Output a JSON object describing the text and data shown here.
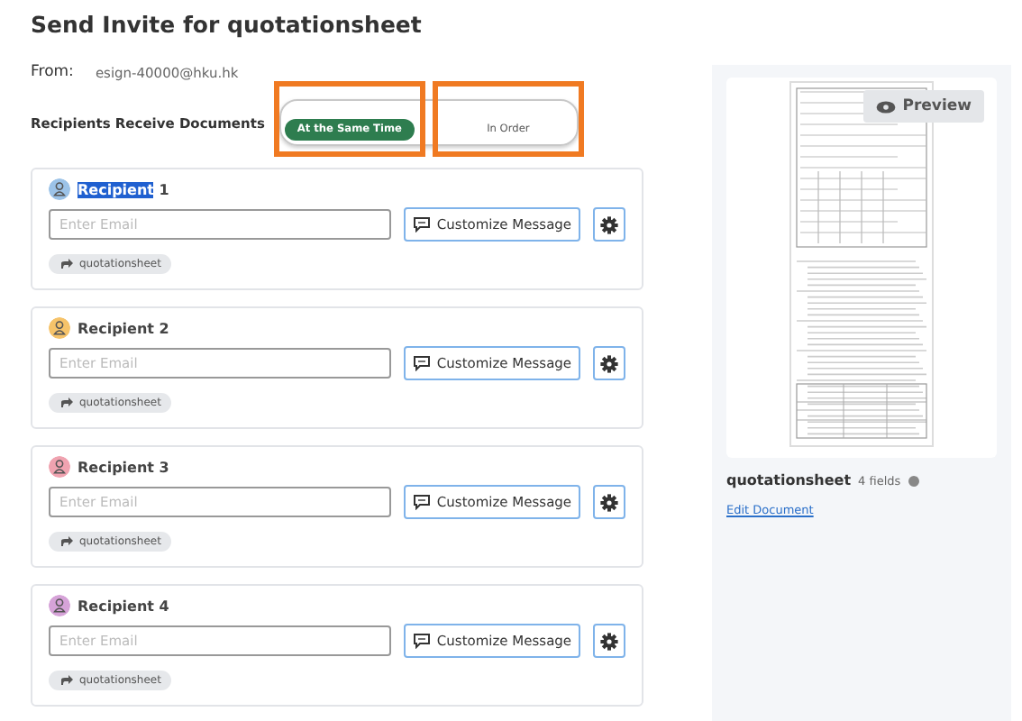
{
  "title": "Send Invite for quotationsheet",
  "from": {
    "label": "From:",
    "value": "esign-40000@hku.hk"
  },
  "receive_mode": {
    "label": "Recipients Receive Documents",
    "options": [
      {
        "label": "At the Same Time",
        "selected": true,
        "annotated": true
      },
      {
        "label": "In Order",
        "selected": false,
        "annotated": true
      }
    ]
  },
  "recipients": [
    {
      "label": "Recipient",
      "number": "1",
      "label_highlighted": true,
      "color": "#9cc3e8",
      "email_placeholder": "Enter Email",
      "message_button": "Customize Message",
      "document_tag": "quotationsheet"
    },
    {
      "label": "Recipient",
      "number": "2",
      "label_highlighted": false,
      "color": "#f6c36a",
      "email_placeholder": "Enter Email",
      "message_button": "Customize Message",
      "document_tag": "quotationsheet"
    },
    {
      "label": "Recipient",
      "number": "3",
      "label_highlighted": false,
      "color": "#f0a3b0",
      "email_placeholder": "Enter Email",
      "message_button": "Customize Message",
      "document_tag": "quotationsheet"
    },
    {
      "label": "Recipient",
      "number": "4",
      "label_highlighted": false,
      "color": "#d6a3d8",
      "email_placeholder": "Enter Email",
      "message_button": "Customize Message",
      "document_tag": "quotationsheet"
    }
  ],
  "document": {
    "preview_button": "Preview",
    "name": "quotationsheet",
    "fields": "4 fields",
    "edit_link": "Edit Document"
  }
}
